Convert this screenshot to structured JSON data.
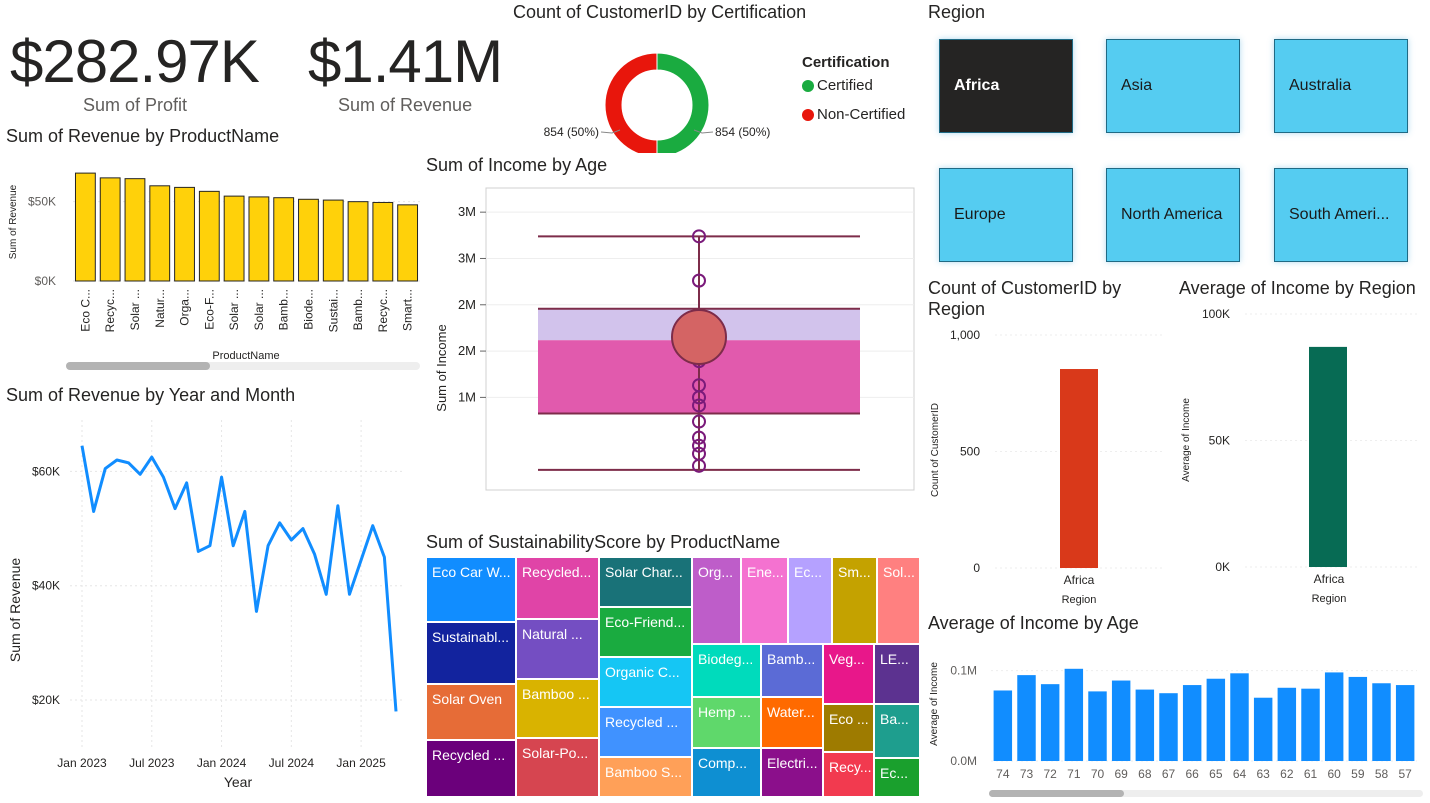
{
  "kpis": {
    "profit_value": "$282.97K",
    "profit_label": "Sum of Profit",
    "revenue_value": "$1.41M",
    "revenue_label": "Sum of Revenue"
  },
  "region_slicer": {
    "title": "Region",
    "options": [
      {
        "label": "Africa",
        "selected": true
      },
      {
        "label": "Asia",
        "selected": false
      },
      {
        "label": "Australia",
        "selected": false
      },
      {
        "label": "Europe",
        "selected": false
      },
      {
        "label": "North America",
        "selected": false
      },
      {
        "label": "South Ameri...",
        "selected": false
      }
    ]
  },
  "colors": {
    "yellow_bar": "#ffd10a",
    "line_blue": "#118dff",
    "certified": "#1aab40",
    "non_certified": "#e8160c",
    "region_count_bar": "#d9391a",
    "region_income_bar": "#076b54",
    "slicer_blue": "#55ccf1",
    "slicer_selected": "#252423"
  },
  "chart_data": [
    {
      "id": "revenue_by_product",
      "type": "bar",
      "title": "Sum of Revenue by ProductName",
      "xlabel": "ProductName",
      "ylabel": "Sum of Revenue",
      "yticks": [
        "$0K",
        "$50K"
      ],
      "ylim": [
        0,
        75000
      ],
      "categories": [
        "Eco C...",
        "Recyc...",
        "Solar ...",
        "Natur...",
        "Orga...",
        "Eco-F...",
        "Solar ...",
        "Solar ...",
        "Bamb...",
        "Biode...",
        "Sustai...",
        "Bamb...",
        "Recyc...",
        "Smart..."
      ],
      "values": [
        68000,
        65000,
        64500,
        60000,
        59000,
        56500,
        53500,
        53000,
        52500,
        51500,
        51000,
        50000,
        49500,
        48000
      ]
    },
    {
      "id": "certification_donut",
      "type": "pie",
      "title": "Count of CustomerID by Certification",
      "legend_title": "Certification",
      "categories": [
        "Certified",
        "Non-Certified"
      ],
      "values": [
        854,
        854
      ],
      "labels": [
        "854 (50%)",
        "854 (50%)"
      ]
    },
    {
      "id": "income_by_age",
      "type": "scatter",
      "title": "Sum of Income by Age",
      "ylabel": "Sum of Income",
      "yticks": [
        "1M",
        "2M",
        "2M",
        "3M",
        "3M"
      ],
      "ylim": [
        0,
        3750000
      ],
      "box": {
        "min": 250000,
        "q1": 950000,
        "median": 1550000,
        "q3": 2250000,
        "max": 3150000,
        "mean": 1900000
      },
      "points": [
        3150000,
        2600000,
        2150000,
        1950000,
        1850000,
        1700000,
        1600000,
        1300000,
        1150000,
        1050000,
        850000,
        650000,
        550000,
        450000,
        300000
      ]
    },
    {
      "id": "revenue_by_month",
      "type": "line",
      "title": "Sum of Revenue by Year and Month",
      "xlabel": "Year",
      "ylabel": "Sum of Revenue",
      "xticks": [
        "Jan 2023",
        "Jul 2023",
        "Jan 2024",
        "Jul 2024",
        "Jan 2025"
      ],
      "yticks": [
        "$20K",
        "$40K",
        "$60K"
      ],
      "ylim": [
        13000,
        69000
      ],
      "x": [
        "2023-01",
        "2023-02",
        "2023-03",
        "2023-04",
        "2023-05",
        "2023-06",
        "2023-07",
        "2023-08",
        "2023-09",
        "2023-10",
        "2023-11",
        "2023-12",
        "2024-01",
        "2024-02",
        "2024-03",
        "2024-04",
        "2024-05",
        "2024-06",
        "2024-07",
        "2024-08",
        "2024-09",
        "2024-10",
        "2024-11",
        "2024-12",
        "2025-01",
        "2025-02",
        "2025-03",
        "2025-04"
      ],
      "values": [
        64500,
        53000,
        60500,
        62000,
        61500,
        59500,
        62500,
        59000,
        53500,
        58000,
        46000,
        47000,
        59000,
        47000,
        53000,
        35500,
        47000,
        51000,
        48000,
        50000,
        45500,
        38500,
        54000,
        38500,
        44500,
        50500,
        45000,
        18000
      ]
    },
    {
      "id": "sustainability_treemap",
      "type": "treemap",
      "title": "Sum of SustainabilityScore by ProductName",
      "cells": [
        {
          "label": "Eco Car W...",
          "color": "#118dff"
        },
        {
          "label": "Sustainabl...",
          "color": "#12239e"
        },
        {
          "label": "Solar Oven",
          "color": "#e66c37"
        },
        {
          "label": "Recycled ...",
          "color": "#6b007b"
        },
        {
          "label": "Recycled...",
          "color": "#e044a7"
        },
        {
          "label": "Natural ...",
          "color": "#744ec2"
        },
        {
          "label": "Bamboo ...",
          "color": "#d9b300"
        },
        {
          "label": "Solar-Po...",
          "color": "#d64550"
        },
        {
          "label": "Solar Char...",
          "color": "#197278"
        },
        {
          "label": "Eco-Friend...",
          "color": "#1aab40"
        },
        {
          "label": "Organic C...",
          "color": "#15c6f4"
        },
        {
          "label": "Recycled ...",
          "color": "#4092ff"
        },
        {
          "label": "Bamboo S...",
          "color": "#ffa058"
        },
        {
          "label": "Org...",
          "color": "#be5dc9"
        },
        {
          "label": "Ene...",
          "color": "#f472d0"
        },
        {
          "label": "Ec...",
          "color": "#b5a1ff"
        },
        {
          "label": "Sm...",
          "color": "#c4a200"
        },
        {
          "label": "Sol...",
          "color": "#ff8080"
        },
        {
          "label": "Biodeg...",
          "color": "#00dbbc"
        },
        {
          "label": "Bamb...",
          "color": "#5b6bd6"
        },
        {
          "label": "Veg...",
          "color": "#e8178a"
        },
        {
          "label": "LE...",
          "color": "#5c3290"
        },
        {
          "label": "Hemp ...",
          "color": "#5fd86b"
        },
        {
          "label": "Water...",
          "color": "#ff6a00"
        },
        {
          "label": "Eco ...",
          "color": "#9e7b00"
        },
        {
          "label": "Ba...",
          "color": "#1e9e8e"
        },
        {
          "label": "Comp...",
          "color": "#0e8fd2"
        },
        {
          "label": "Electri...",
          "color": "#8b0f8b"
        },
        {
          "label": "Recy...",
          "color": "#f23a4f"
        },
        {
          "label": "Ec...",
          "color": "#1aa02d"
        }
      ]
    },
    {
      "id": "count_by_region",
      "type": "bar",
      "title": "Count of CustomerID by Region",
      "xlabel": "Region",
      "ylabel": "Count of CustomerID",
      "yticks": [
        "0",
        "500",
        "1,000"
      ],
      "ylim": [
        0,
        1000
      ],
      "categories": [
        "Africa"
      ],
      "values": [
        854
      ]
    },
    {
      "id": "income_by_region",
      "type": "bar",
      "title": "Average of Income by Region",
      "xlabel": "Region",
      "ylabel": "Average of Income",
      "yticks": [
        "0K",
        "50K",
        "100K"
      ],
      "ylim": [
        0,
        100000
      ],
      "categories": [
        "Africa"
      ],
      "values": [
        87000
      ]
    },
    {
      "id": "income_by_age_bar",
      "type": "bar",
      "title": "Average of Income by Age",
      "ylabel": "Average of Income",
      "yticks": [
        "0.0M",
        "0.1M"
      ],
      "ylim": [
        0,
        0.125
      ],
      "categories": [
        "74",
        "73",
        "72",
        "71",
        "70",
        "69",
        "68",
        "67",
        "66",
        "65",
        "64",
        "63",
        "62",
        "61",
        "60",
        "59",
        "58",
        "57"
      ],
      "values": [
        0.078,
        0.095,
        0.085,
        0.102,
        0.077,
        0.089,
        0.079,
        0.075,
        0.084,
        0.091,
        0.097,
        0.07,
        0.081,
        0.08,
        0.098,
        0.093,
        0.086,
        0.084
      ]
    }
  ]
}
